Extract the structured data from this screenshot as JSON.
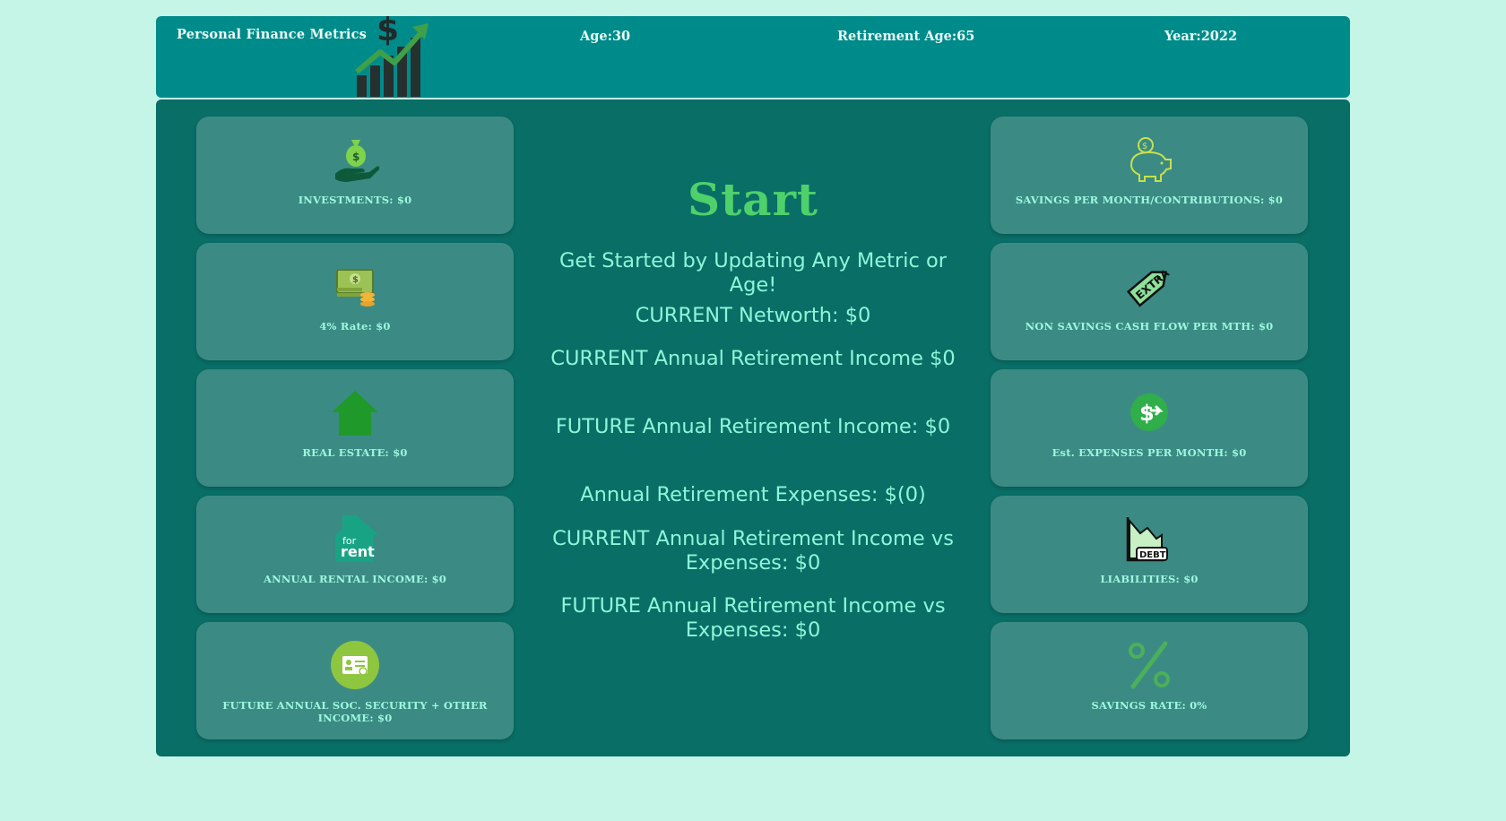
{
  "header": {
    "title": "Personal Finance Metrics",
    "age": "Age:30",
    "retirement_age": "Retirement Age:65",
    "year": "Year:2022"
  },
  "left_cards": [
    {
      "icon": "money-bag-hand-icon",
      "label": "INVESTMENTS: $0"
    },
    {
      "icon": "cash-coins-icon",
      "label": "4% Rate: $0"
    },
    {
      "icon": "house-icon",
      "label": "REAL ESTATE: $0"
    },
    {
      "icon": "for-rent-house-icon",
      "label": "ANNUAL RENTAL INCOME: $0"
    },
    {
      "icon": "id-card-icon",
      "label": "FUTURE ANNUAL SOC. SECURITY + OTHER INCOME: $0"
    }
  ],
  "right_cards": [
    {
      "icon": "piggy-bank-icon",
      "label": "SAVINGS PER MONTH/CONTRIBUTIONS: $0"
    },
    {
      "icon": "extra-tag-icon",
      "label": "NON SAVINGS CASH FLOW PER MTH: $0"
    },
    {
      "icon": "dollar-circle-arrow-icon",
      "label": "Est. EXPENSES PER MONTH: $0"
    },
    {
      "icon": "debt-chart-icon",
      "label": "LIABILITIES: $0"
    },
    {
      "icon": "percent-icon",
      "label": "SAVINGS RATE: 0%"
    }
  ],
  "center": {
    "start": "Start",
    "intro": "Get Started by Updating Any Metric or Age!",
    "networth": "CURRENT Networth: $0",
    "current_income": "CURRENT Annual Retirement Income $0",
    "future_income": "FUTURE Annual Retirement Income: $0",
    "expenses": "Annual Retirement Expenses: $(0)",
    "current_vs": "CURRENT Annual Retirement Income vs Expenses: $0",
    "future_vs": "FUTURE Annual Retirement Income vs Expenses: $0"
  },
  "colors": {
    "page_bg": "#c4f5e6",
    "header_bg": "#008b8b",
    "main_bg": "#096e66",
    "card_bg": "#3b8b84",
    "label": "#9ef7de",
    "start": "#4ed16a"
  }
}
